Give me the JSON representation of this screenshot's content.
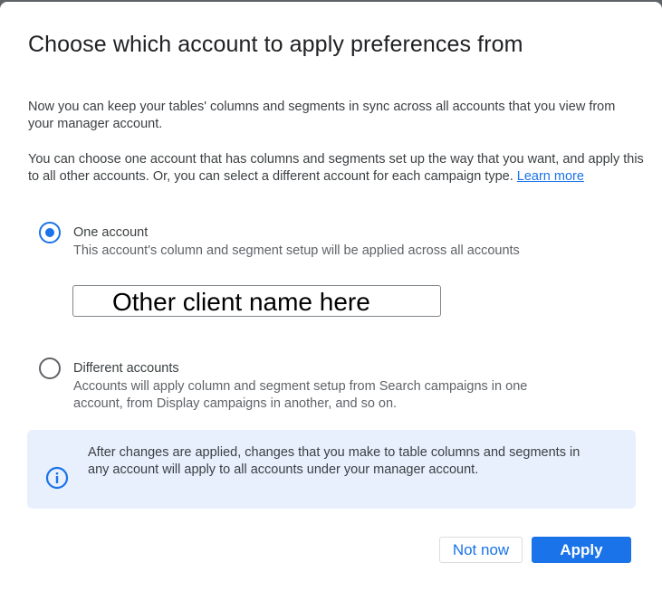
{
  "dialog": {
    "title": "Choose which account to apply preferences from",
    "paragraph1": "Now you can keep your tables' columns and segments in sync across all accounts that you view from your manager account.",
    "paragraph2": "You can choose one account that has columns and segments set up the way that you want, and apply this to all other accounts. Or, you can select a different account for each campaign type.",
    "learn_more": "Learn more"
  },
  "options": [
    {
      "label": "One account",
      "description": "This account's column and segment setup will be applied across all accounts",
      "selected": true
    },
    {
      "label": "Different accounts",
      "description": "Accounts will apply column and segment setup from Search campaigns in one account, from Display campaigns in another, and so on.",
      "selected": false
    }
  ],
  "account_selector": {
    "value": "Other client name here"
  },
  "info": {
    "text": "After changes are applied, changes that you make to table columns and segments in any account will apply to all accounts under your manager account.",
    "icon": "info-icon"
  },
  "actions": {
    "not_now": "Not now",
    "apply": "Apply"
  },
  "colors": {
    "accent": "#1a73e8",
    "info_background": "#e8f0fe",
    "text_primary": "#202124",
    "text_secondary": "#5f6368"
  }
}
